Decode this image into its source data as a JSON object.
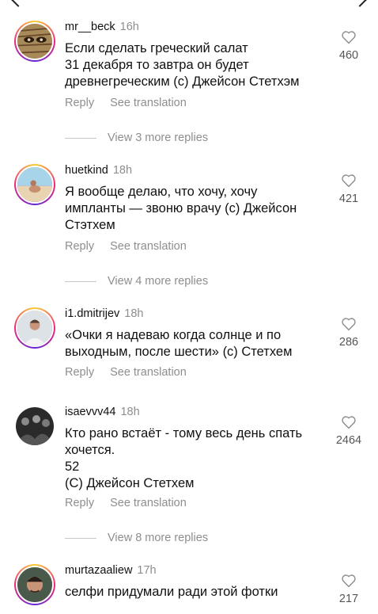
{
  "comments": [
    {
      "username": "mr__beck",
      "time": "16h",
      "text": "Если сделать греческий салат\n31 декабря то завтра он будет\nдревнегреческим (с) Джейсон Стетхэм",
      "likes": "460",
      "reply_label": "Reply",
      "translate_label": "See translation",
      "avatar": "mask-avatar",
      "view_more": "View 3 more replies"
    },
    {
      "username": "huetkind",
      "time": "18h",
      "text": "Я вообще делаю, что хочу, хочу\nимпланты — звоню врачу (с) Джейсон\nСтэтхем",
      "likes": "421",
      "reply_label": "Reply",
      "translate_label": "See translation",
      "avatar": "beach-avatar",
      "view_more": "View 4 more replies"
    },
    {
      "username": "i1.dmitrijev",
      "time": "18h",
      "text": "«Очки я надеваю когда солнце и по\nвыходным, после шести» (с) Стетхем",
      "likes": "286",
      "reply_label": "Reply",
      "translate_label": "See translation",
      "avatar": "man-avatar"
    },
    {
      "username": "isaevvv44",
      "time": "18h",
      "text": "Кто рано встаёт - тому весь день спать\nхочется.\n52\n(С) Джейсон Стетхем",
      "likes": "2464",
      "reply_label": "Reply",
      "translate_label": "See translation",
      "avatar": "group-avatar",
      "view_more": "View 8 more replies"
    },
    {
      "username": "murtazaaliew",
      "time": "17h",
      "text": "селфи придумали ради этой фотки",
      "likes": "217",
      "avatar": "selfie-avatar"
    }
  ],
  "colors": {
    "secondary_text": "#8e8e8e",
    "primary_text": "#111111",
    "story_ring": [
      "#f9ce34",
      "#ee2a7b",
      "#6228d7"
    ]
  }
}
